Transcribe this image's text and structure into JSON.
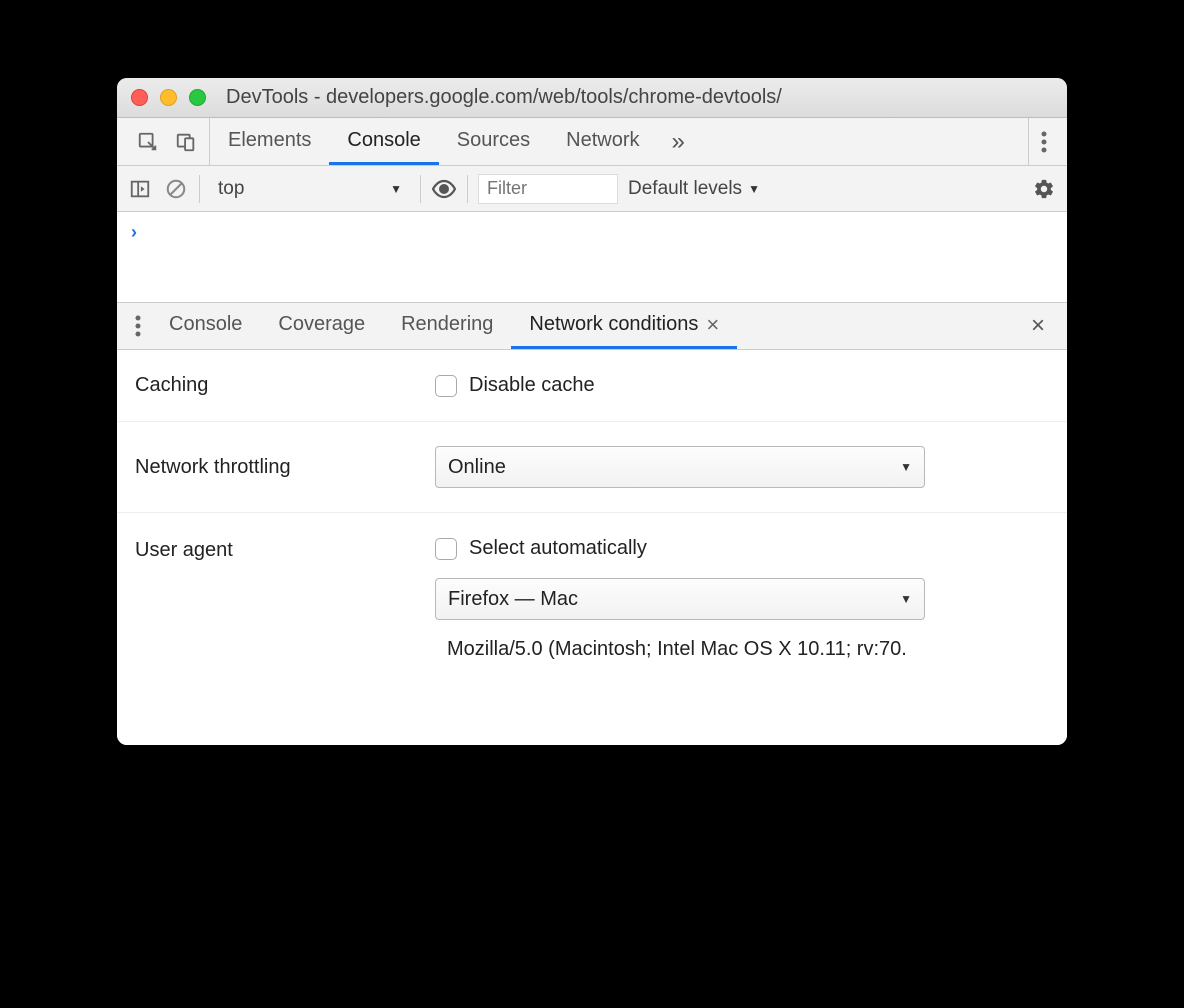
{
  "window": {
    "title": "DevTools - developers.google.com/web/tools/chrome-devtools/"
  },
  "toolbar": {
    "tabs": [
      "Elements",
      "Console",
      "Sources",
      "Network"
    ],
    "active_tab": "Console"
  },
  "console_bar": {
    "context": "top",
    "filter_placeholder": "Filter",
    "levels": "Default levels"
  },
  "drawer": {
    "tabs": [
      "Console",
      "Coverage",
      "Rendering",
      "Network conditions"
    ],
    "active_tab": "Network conditions"
  },
  "network_conditions": {
    "caching_label": "Caching",
    "disable_cache_label": "Disable cache",
    "throttling_label": "Network throttling",
    "throttling_value": "Online",
    "ua_label": "User agent",
    "ua_auto_label": "Select automatically",
    "ua_value": "Firefox — Mac",
    "ua_string": "Mozilla/5.0 (Macintosh; Intel Mac OS X 10.11; rv:70."
  }
}
